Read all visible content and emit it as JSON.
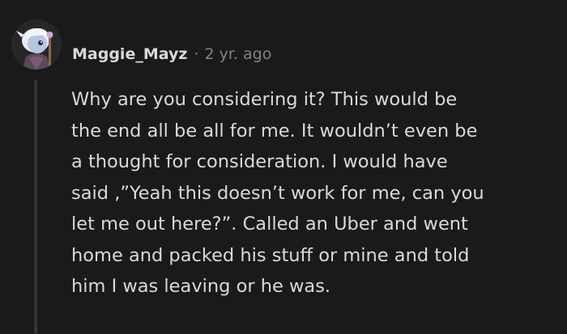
{
  "comment": {
    "author": "Maggie_Mayz",
    "separator": "·",
    "timestamp": "2 yr. ago",
    "body_lines": [
      "Why are you considering it? This would be",
      "the end all be all for me. It wouldn’t even be",
      "a thought for consideration. I would have",
      "said ,”Yeah this doesn’t work for me, can you",
      "let me out here?”. Called an Uber and went",
      "home and packed his stuff or mine and told",
      "him I was leaving or he was."
    ]
  },
  "colors": {
    "background": "#1a1a1b",
    "text": "#d7dadc",
    "meta": "#818384",
    "thread_line": "#343536"
  }
}
